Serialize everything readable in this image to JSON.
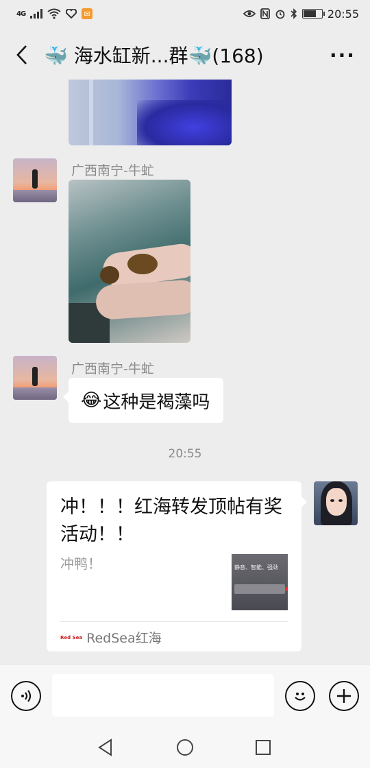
{
  "status_bar": {
    "network": "4G",
    "time": "20:55",
    "battery_level": 0.7
  },
  "header": {
    "title": "🐳 海水缸新...群🐳(168)",
    "back_icon": "chevron-left-icon",
    "more_label": "···"
  },
  "messages": [
    {
      "type": "image",
      "sender": "",
      "description_icon": "image"
    },
    {
      "type": "image",
      "sender": "广西南宁-牛虻"
    },
    {
      "type": "text",
      "sender": "广西南宁-牛虻",
      "emoji": "😂",
      "text": "这种是褐藻吗"
    },
    {
      "type": "time",
      "text": "20:55"
    },
    {
      "type": "link",
      "sender": "me",
      "title": "冲！！！红海转发顶帖有奖活动！！",
      "desc": "冲鸭！",
      "thumb_text": "静音、智能、强劲",
      "source_logo": "Red Sea",
      "source": "RedSea红海"
    }
  ],
  "input": {
    "placeholder": ""
  },
  "colors": {
    "background": "#ededed",
    "bubble": "#ffffff",
    "name": "#8a8a8a"
  }
}
